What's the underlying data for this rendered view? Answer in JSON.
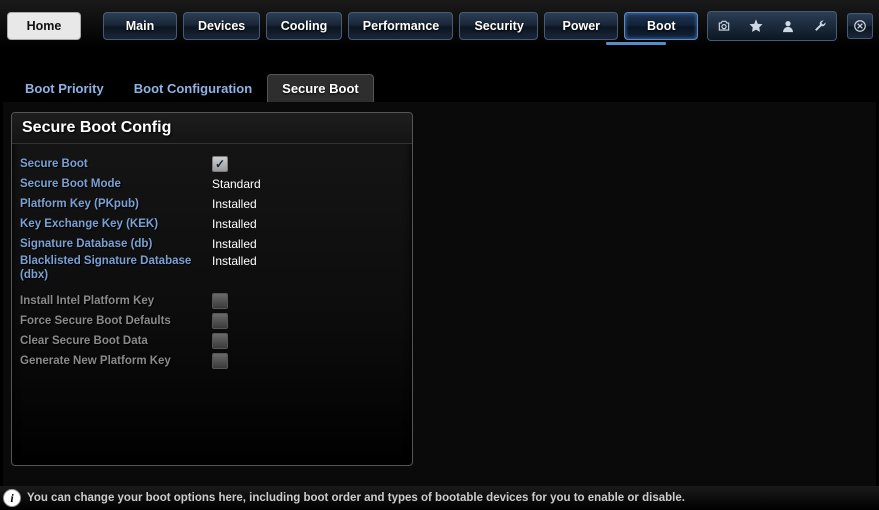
{
  "nav": {
    "home": "Home",
    "items": [
      "Main",
      "Devices",
      "Cooling",
      "Performance",
      "Security",
      "Power",
      "Boot"
    ],
    "active_index": 6,
    "icons": [
      "camera-icon",
      "star-icon",
      "user-icon",
      "wrench-icon"
    ],
    "exit_icon": "close-circle-icon"
  },
  "subtabs": {
    "items": [
      "Boot Priority",
      "Boot Configuration",
      "Secure Boot"
    ],
    "active_index": 2
  },
  "panel": {
    "title": "Secure Boot Config",
    "rows": [
      {
        "label": "Secure Boot",
        "kind": "checkbox",
        "checked": true
      },
      {
        "label": "Secure Boot Mode",
        "kind": "text",
        "value": "Standard"
      },
      {
        "label": "Platform Key (PKpub)",
        "kind": "text",
        "value": "Installed"
      },
      {
        "label": "Key Exchange Key (KEK)",
        "kind": "text",
        "value": "Installed"
      },
      {
        "label": "Signature Database (db)",
        "kind": "text",
        "value": "Installed"
      },
      {
        "label": "Blacklisted Signature Database (dbx)",
        "kind": "text",
        "value": "Installed",
        "multiline": true
      }
    ],
    "gray_rows": [
      {
        "label": "Install Intel Platform Key",
        "kind": "checkbox",
        "checked": false
      },
      {
        "label": "Force Secure Boot Defaults",
        "kind": "checkbox",
        "checked": false
      },
      {
        "label": "Clear Secure Boot Data",
        "kind": "checkbox",
        "checked": false
      },
      {
        "label": "Generate New Platform Key",
        "kind": "checkbox",
        "checked": false
      }
    ]
  },
  "footer": {
    "text": "You can change your boot options here, including boot order and types of bootable devices for you to enable or disable."
  }
}
